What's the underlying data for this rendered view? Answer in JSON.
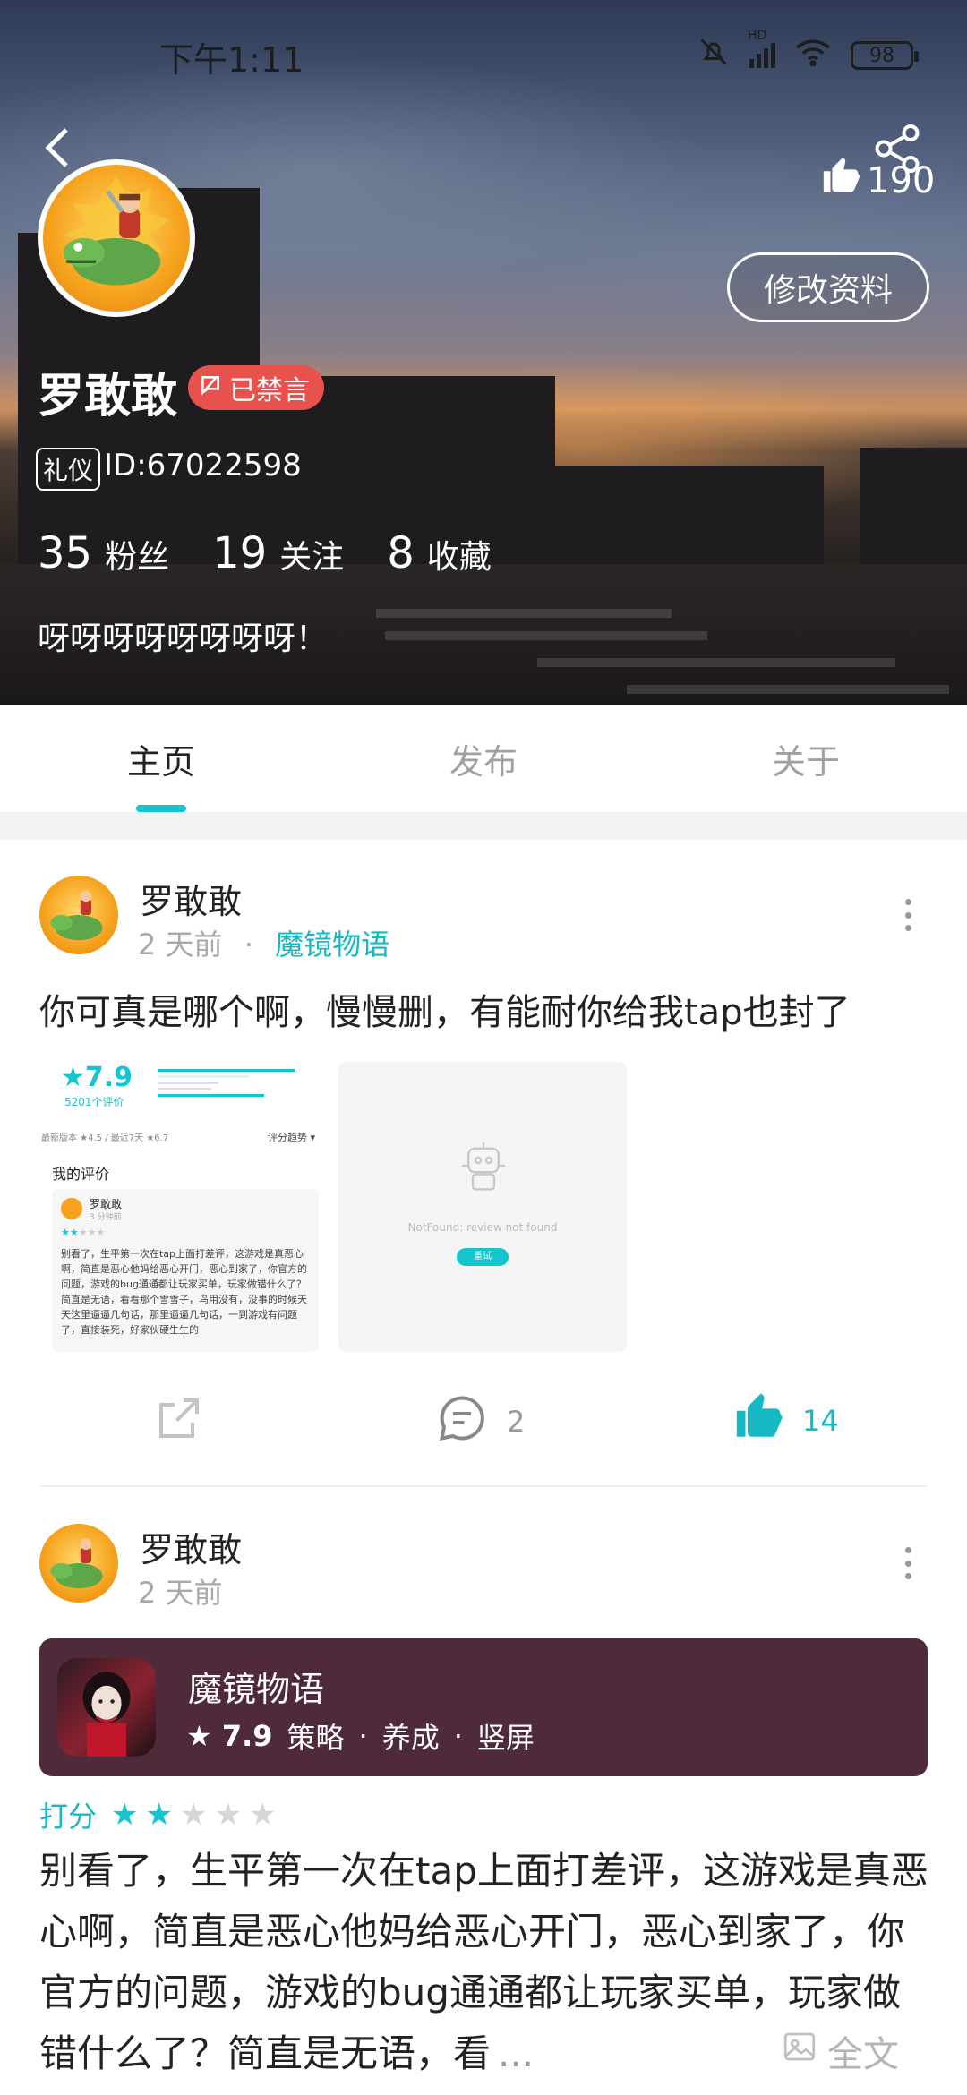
{
  "status_bar": {
    "time": "下午1:11",
    "battery": "98",
    "net": "HD"
  },
  "profile": {
    "likes": "190",
    "edit_label": "修改资料",
    "name": "罗敢敢",
    "banned_label": "已禁言",
    "badge": "礼仪",
    "id_text": "ID:67022598",
    "stats": [
      {
        "num": "35",
        "label": "粉丝"
      },
      {
        "num": "19",
        "label": "关注"
      },
      {
        "num": "8",
        "label": "收藏"
      }
    ],
    "bio": "呀呀呀呀呀呀呀呀！"
  },
  "tabs": [
    {
      "label": "主页",
      "active": true
    },
    {
      "label": "发布",
      "active": false
    },
    {
      "label": "关于",
      "active": false
    }
  ],
  "post1": {
    "author": "罗敢敢",
    "time": "2 天前",
    "dot": "·",
    "game": "魔镜物语",
    "text": "你可真是哪个啊，慢慢删，有能耐你给我tap也封了",
    "thumb1": {
      "rating": "7.9",
      "reviews": "5201个评价",
      "recent": "最新版本 ★4.5 / 最近7天 ★6.7",
      "trend": "评分趋势 ▾",
      "my_review": "我的评价",
      "card_name": "罗敢敢",
      "card_time": "3 分钟前",
      "card_text": "别看了，生平第一次在tap上面打差评，这游戏是真恶心啊，简直是恶心他妈给恶心开门，恶心到家了，你官方的问题，游戏的bug通通都让玩家买单，玩家做错什么了？简直是无语，看看那个雪雪子，鸟用没有，没事的时候天天这里逼逼几句话，那里逼逼几句话，一到游戏有问题了，直接装死，好家伙硬生生的"
    },
    "thumb2": {
      "error": "NotFound: review not found",
      "retry": "重试"
    },
    "comments": "2",
    "likes": "14"
  },
  "post2": {
    "author": "罗敢敢",
    "time": "2 天前",
    "game_card": {
      "title": "魔镜物语",
      "rating": "7.9",
      "tags": [
        "策略",
        "养成",
        "竖屏"
      ],
      "tag_sep": "·"
    },
    "rating_label": "打分",
    "rating_stars": 2,
    "rating_max": 5,
    "review": "别看了，生平第一次在tap上面打差评，这游戏是真恶心啊，简直是恶心他妈给恶心开门，恶心到家了，你官方的问题，游戏的bug通通都让玩家买单，玩家做错什么了？简直是无语，看",
    "ellipsis": "...",
    "full_label": "全文"
  },
  "colors": {
    "accent": "#15c5ce",
    "banned": "#e8514c",
    "game_card_bg": "#4e2a3a"
  }
}
